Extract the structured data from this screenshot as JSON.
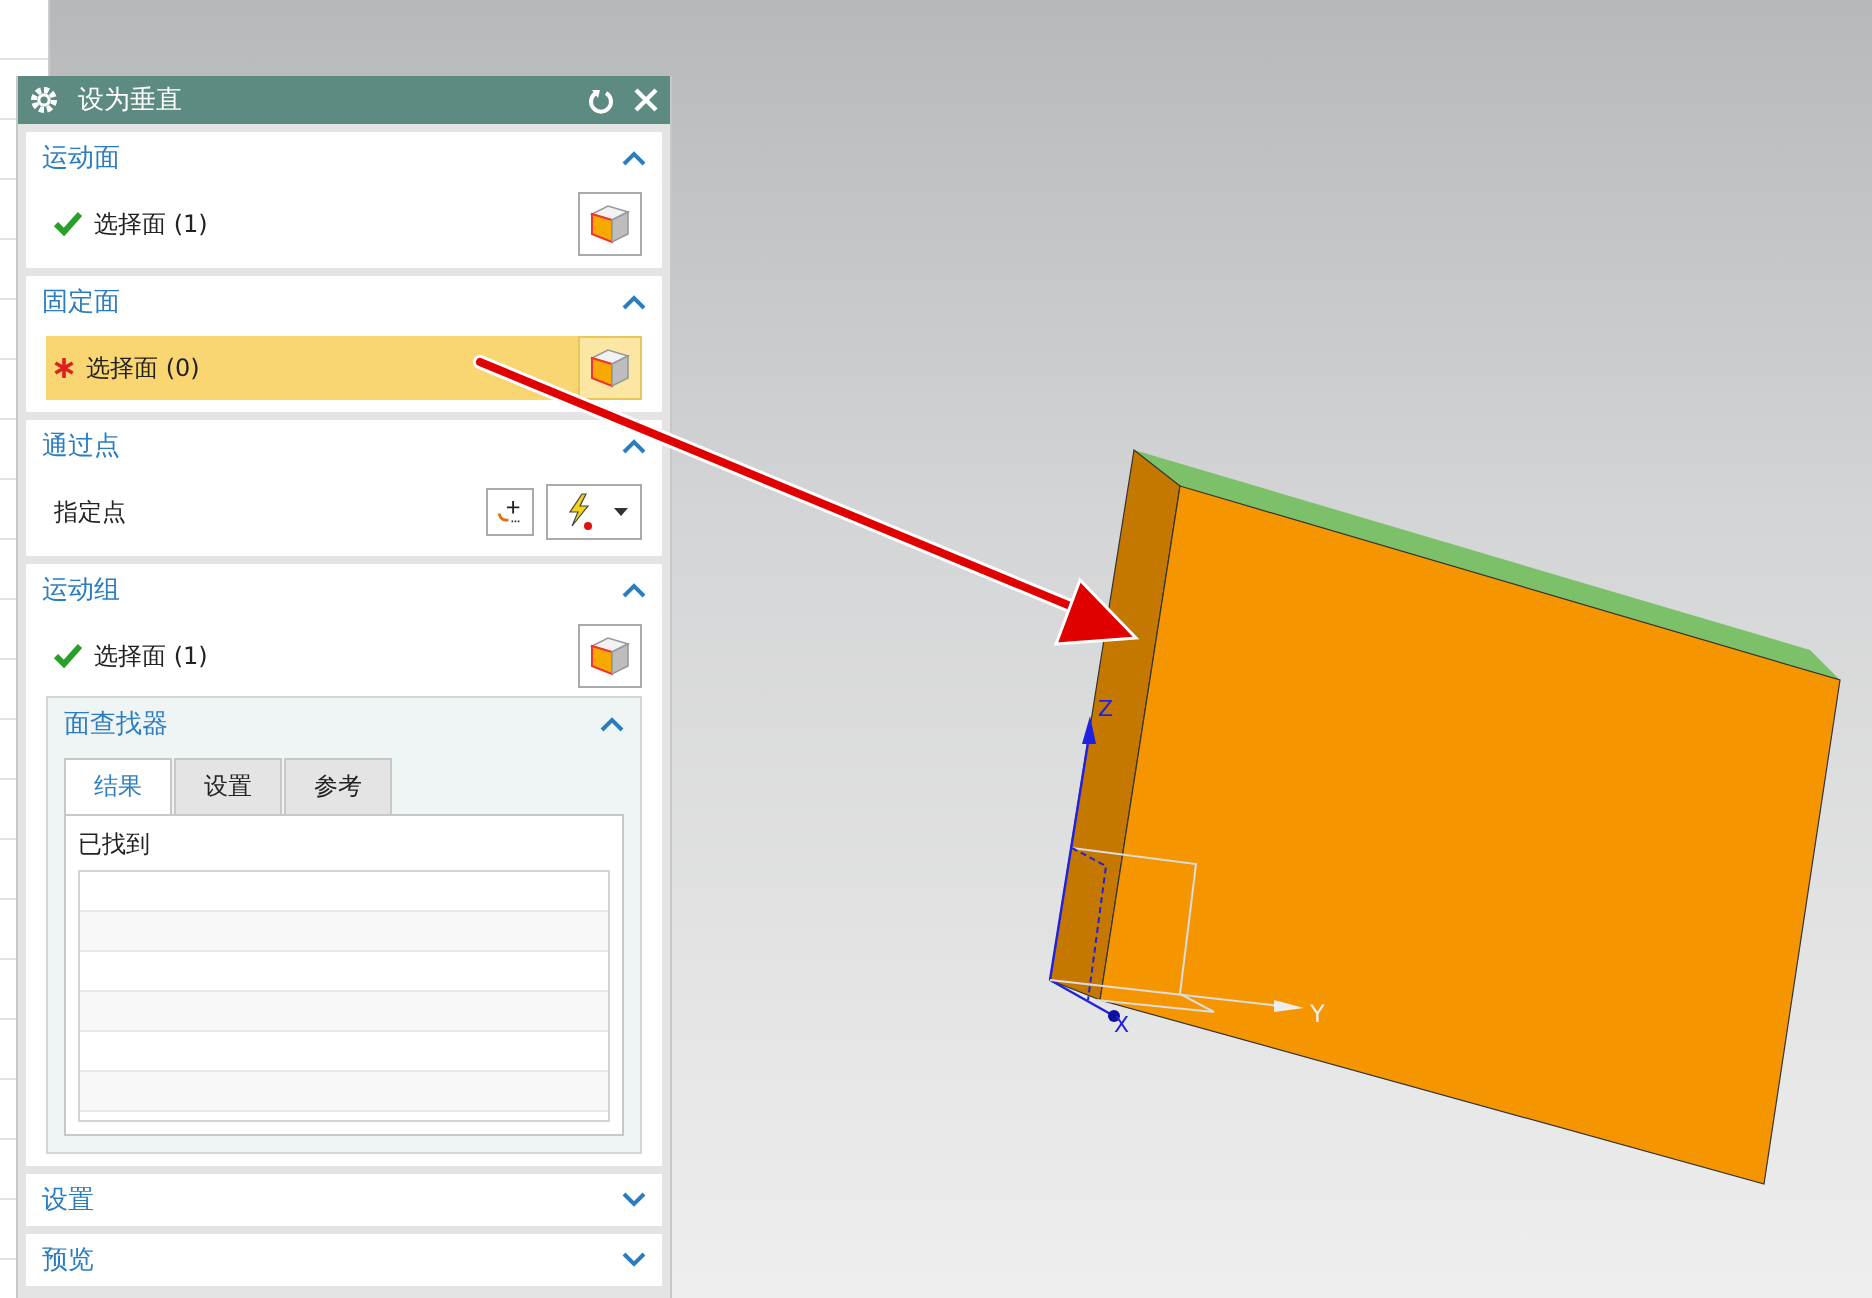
{
  "window": {
    "title": "设为垂直"
  },
  "sections": [
    {
      "title": "运动面",
      "expanded": true,
      "kind": "select",
      "complete": true,
      "label": "选择面 (1)",
      "active": false
    },
    {
      "title": "固定面",
      "expanded": true,
      "kind": "select",
      "complete": false,
      "label": "选择面 (0)",
      "active": true
    },
    {
      "title": "通过点",
      "expanded": true,
      "kind": "point",
      "label": "指定点"
    },
    {
      "title": "运动组",
      "expanded": true,
      "kind": "finder",
      "complete": true,
      "label": "选择面 (1)",
      "active": false,
      "finder": {
        "title": "面查找器",
        "expanded": true,
        "tabs": [
          {
            "label": "结果",
            "selected": true
          },
          {
            "label": "设置",
            "selected": false
          },
          {
            "label": "参考",
            "selected": false
          }
        ],
        "found_label": "已找到"
      }
    },
    {
      "title": "设置",
      "expanded": false
    },
    {
      "title": "预览",
      "expanded": false
    }
  ],
  "viewport": {
    "axis_labels": [
      {
        "label": "Z"
      },
      {
        "label": "X"
      },
      {
        "label": "Y"
      }
    ]
  }
}
